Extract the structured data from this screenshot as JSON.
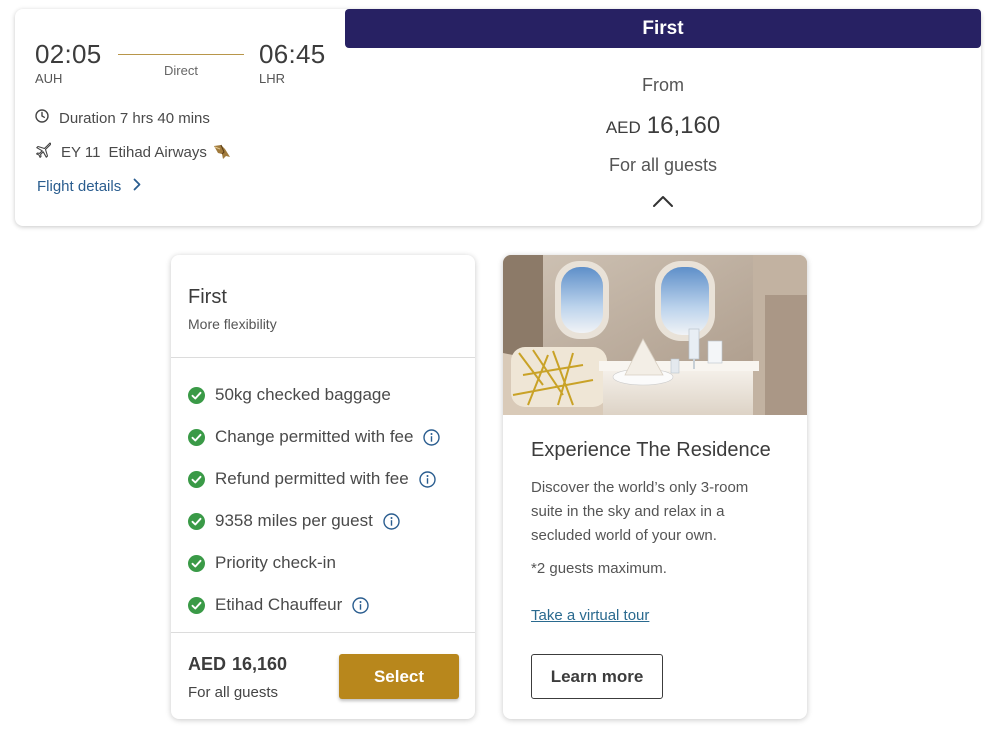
{
  "flight": {
    "departure_time": "02:05",
    "departure_code": "AUH",
    "arrival_time": "06:45",
    "arrival_code": "LHR",
    "stops": "Direct",
    "duration": "Duration 7 hrs 40 mins",
    "flight_number": "EY 11",
    "airline": "Etihad Airways",
    "details_link": "Flight details",
    "cabin": "First",
    "from_label": "From",
    "currency": "AED",
    "price": "16,160",
    "guests_label": "For all guests"
  },
  "fare": {
    "name": "First",
    "subtitle": "More flexibility",
    "benefits": [
      {
        "label": "50kg checked baggage",
        "info": false
      },
      {
        "label": "Change permitted with fee",
        "info": true
      },
      {
        "label": "Refund permitted with fee",
        "info": true
      },
      {
        "label": "9358 miles per guest",
        "info": true
      },
      {
        "label": "Priority check-in",
        "info": false
      },
      {
        "label": "Etihad Chauffeur",
        "info": true
      }
    ],
    "currency": "AED",
    "price": "16,160",
    "guests_label": "For all guests",
    "select_label": "Select"
  },
  "residence": {
    "title": "Experience The Residence",
    "description": "Discover the world’s only 3-room suite in the sky and relax in a secluded world of your own.",
    "note": "*2 guests maximum.",
    "tour_link": "Take a virtual tour",
    "learn_more_label": "Learn more"
  },
  "colors": {
    "header_bg": "#272163",
    "select_bg": "#b8871c",
    "check_green": "#3a9a47",
    "link_blue": "#2a5d8f",
    "route_gold": "#b8964a"
  },
  "icons": [
    "clock-icon",
    "plane-icon",
    "falcon-logo",
    "chevron-right-icon",
    "chevron-up-icon",
    "check-circle-icon",
    "info-icon"
  ]
}
